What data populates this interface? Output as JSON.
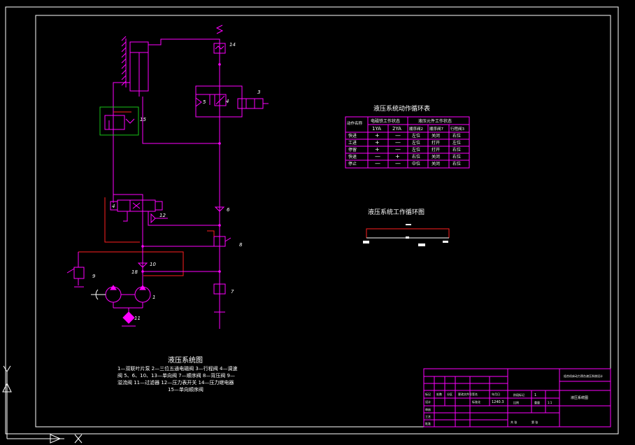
{
  "colors": {
    "background": "#000000",
    "frame": "#ffffff",
    "hydraulic_lines": "#ff00ff",
    "pilot_lines": "#ff2020",
    "highlight_box": "#19c319",
    "text": "#ffffff"
  },
  "diagram": {
    "title": "液压系统图",
    "legend_lines": [
      "1—双联叶片泵  2—三位五通电磁阀  3—行程阀  4—调速",
      "阀  5、6、10、13—单向阀  7—顺序阀  8—背压阀  9—",
      "溢流阀  11—过滤器  12—压力表开关  14—压力继电器",
      "15—单向顺序阀"
    ],
    "component_numbers": [
      "14",
      "3",
      "4",
      "5",
      "15",
      "4",
      "12",
      "6",
      "8",
      "10",
      "18",
      "9",
      "1",
      "11",
      "7"
    ]
  },
  "cycle_table": {
    "title": "液压系统动作循环表",
    "group_headers": [
      "电磁铁工作状态",
      "液压元件工作状态"
    ],
    "columns": [
      "动作名称",
      "1YA",
      "2YA",
      "顺序阀2",
      "顺序阀7",
      "行程阀3"
    ],
    "rows": [
      [
        "快进",
        "+",
        "—",
        "左位",
        "关闭",
        "右位"
      ],
      [
        "工进",
        "+",
        "—",
        "左位",
        "打开",
        "左位"
      ],
      [
        "停留",
        "+",
        "—",
        "左位",
        "打开",
        "右位"
      ],
      [
        "快退",
        "—",
        "+",
        "右位",
        "关闭",
        "右位"
      ],
      [
        "停止",
        "—",
        "—",
        "中位",
        "关闭",
        "右位"
      ]
    ]
  },
  "cycle_chart": {
    "title": "液压系统工作循环图"
  },
  "title_block": {
    "project": "组合机床动力滑台液压系统设计",
    "drawing_name": "液压系统图",
    "scale": "1:1",
    "sheet_count": "1",
    "code": "1240.3",
    "cells": [
      "标记",
      "处数",
      "分区",
      "更改文件号",
      "签名",
      "年月日",
      "设计",
      "标准化",
      "阶段标记",
      "重量",
      "比例",
      "审核",
      "工艺",
      "批准",
      "共 张",
      "第 张"
    ]
  }
}
